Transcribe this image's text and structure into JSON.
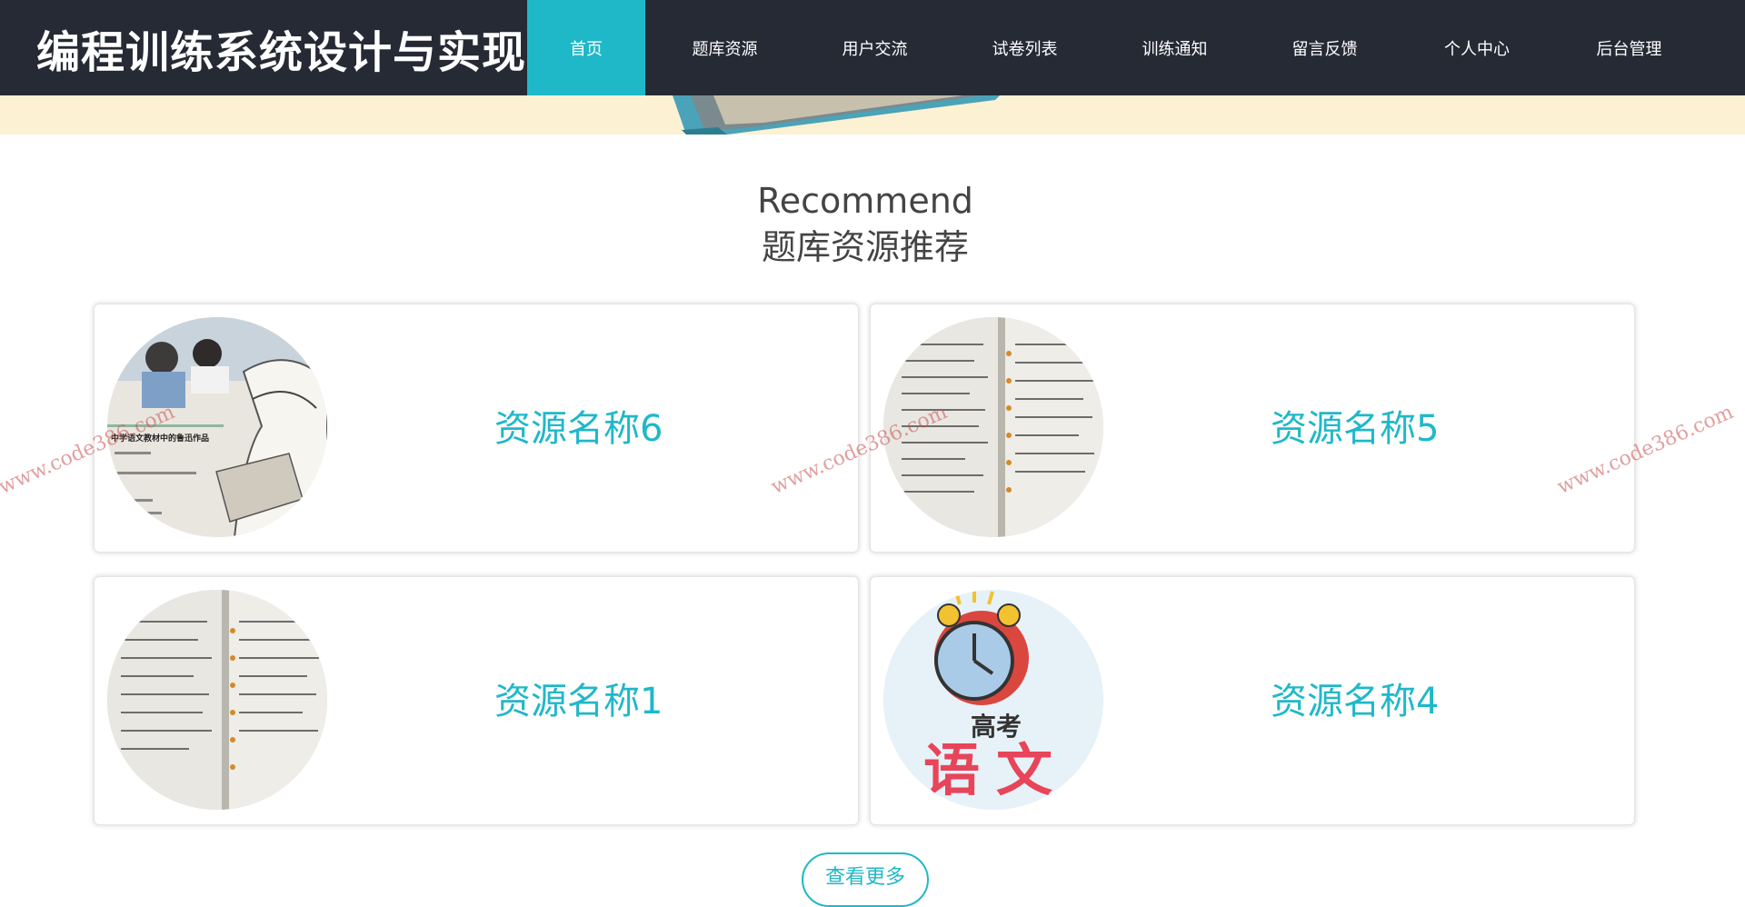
{
  "header": {
    "site_title": "编程训练系统设计与实现",
    "nav": [
      {
        "label": "首页",
        "active": true
      },
      {
        "label": "题库资源",
        "active": false
      },
      {
        "label": "用户交流",
        "active": false
      },
      {
        "label": "试卷列表",
        "active": false
      },
      {
        "label": "训练通知",
        "active": false
      },
      {
        "label": "留言反馈",
        "active": false
      },
      {
        "label": "个人中心",
        "active": false
      },
      {
        "label": "后台管理",
        "active": false
      }
    ]
  },
  "recommend": {
    "title_en": "Recommend",
    "title_cn": "题库资源推荐",
    "cards": [
      {
        "name": "资源名称6"
      },
      {
        "name": "资源名称5"
      },
      {
        "name": "资源名称1"
      },
      {
        "name": "资源名称4"
      }
    ],
    "more_label": "查看更多"
  },
  "thumbs": {
    "card1": {
      "heading": "中学语文教材中的鲁迅作品"
    },
    "card4": {
      "top": "高考",
      "bottom": "语文"
    }
  },
  "watermark": "www.code386.com",
  "colors": {
    "topbar": "#252a34",
    "accent": "#1fb8c9",
    "banner": "#fdf1d4"
  }
}
